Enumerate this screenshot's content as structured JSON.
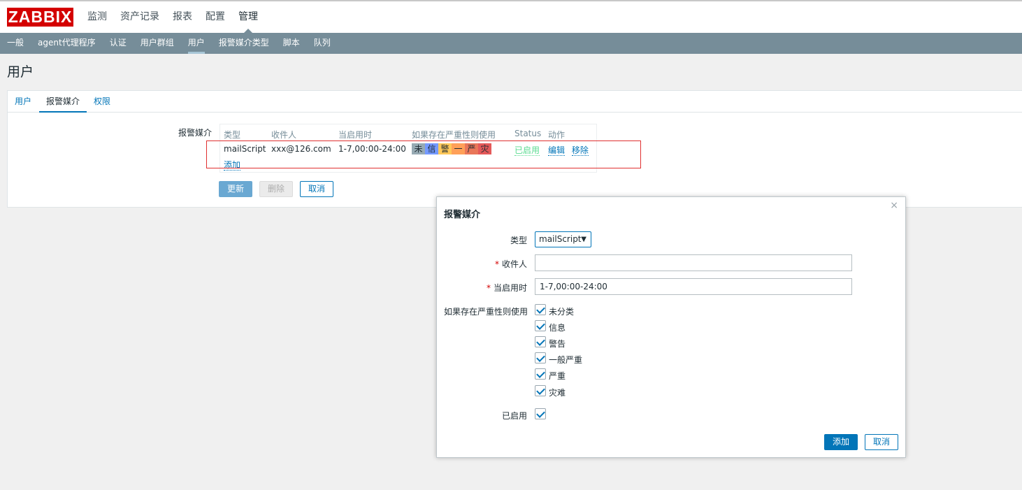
{
  "brand": {
    "logo_text": "ZABBIX",
    "logo_color": "#d40000"
  },
  "top_menu": [
    {
      "label": "监测"
    },
    {
      "label": "资产记录"
    },
    {
      "label": "报表"
    },
    {
      "label": "配置"
    },
    {
      "label": "管理",
      "active": true
    }
  ],
  "sub_menu": [
    {
      "label": "一般"
    },
    {
      "label": "agent代理程序"
    },
    {
      "label": "认证"
    },
    {
      "label": "用户群组"
    },
    {
      "label": "用户",
      "active": true
    },
    {
      "label": "报警媒介类型"
    },
    {
      "label": "脚本"
    },
    {
      "label": "队列"
    }
  ],
  "page": {
    "title": "用户"
  },
  "tabs": [
    {
      "label": "用户"
    },
    {
      "label": "报警媒介",
      "active": true
    },
    {
      "label": "权限"
    }
  ],
  "media": {
    "section_label": "报警媒介",
    "columns": [
      "类型",
      "收件人",
      "当启用时",
      "如果存在严重性则使用",
      "Status",
      "动作"
    ],
    "row": {
      "type": "mailScript",
      "recipient": "xxx@126.com",
      "when_active": "1-7,00:00-24:00",
      "severities": [
        {
          "letter": "未",
          "color": "#97aab3"
        },
        {
          "letter": "信",
          "color": "#7499ff"
        },
        {
          "letter": "警",
          "color": "#ffc859"
        },
        {
          "letter": "一",
          "color": "#ffa059"
        },
        {
          "letter": "严",
          "color": "#e97659"
        },
        {
          "letter": "灾",
          "color": "#e45959"
        }
      ],
      "status": "已启用",
      "edit": "编辑",
      "remove": "移除"
    },
    "add_link": "添加"
  },
  "form_buttons": {
    "update": "更新",
    "delete": "删除",
    "cancel": "取消"
  },
  "dialog": {
    "title": "报警媒介",
    "close": "×",
    "type_label": "类型",
    "type_value": "mailScript",
    "type_arrow": "▼",
    "recipient_label": "收件人",
    "recipient_value": "",
    "when_label": "当启用时",
    "when_value": "1-7,00:00-24:00",
    "severity_label": "如果存在严重性则使用",
    "severities": [
      "未分类",
      "信息",
      "警告",
      "一般严重",
      "严重",
      "灾难"
    ],
    "enabled_label": "已启用",
    "add_button": "添加",
    "cancel_button": "取消",
    "required_mark": "*"
  }
}
